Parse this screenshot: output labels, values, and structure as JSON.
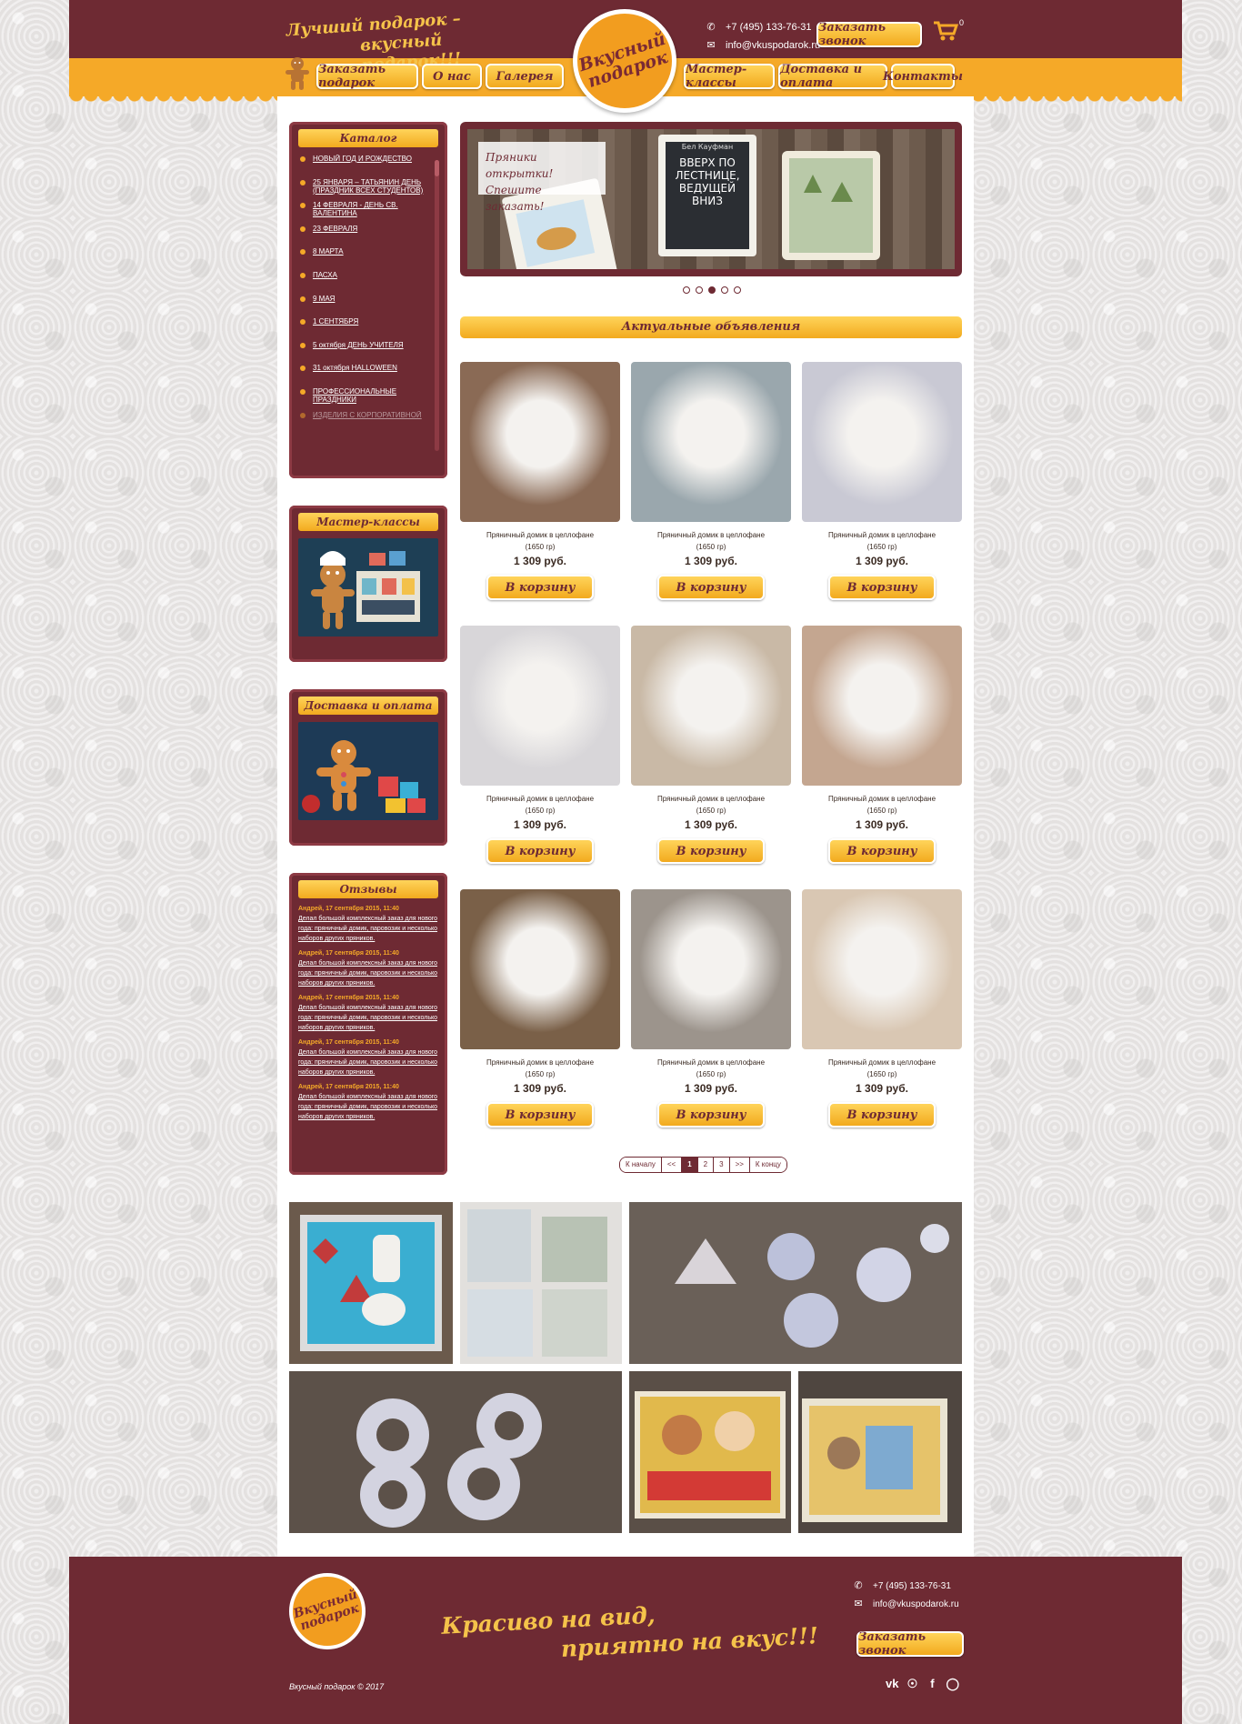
{
  "header": {
    "tagline_1": "Лучший подарок –",
    "tagline_2": "вкусный подарок!!!",
    "logo_text_1": "Вкусный",
    "logo_text_2": "подарок",
    "phone": "+7 (495) 133-76-31",
    "email": "info@vkuspodarok.ru",
    "call_button": "Заказать звонок",
    "cart_count": "0"
  },
  "nav": [
    {
      "label": "Заказать подарок"
    },
    {
      "label": "О нас"
    },
    {
      "label": "Галерея"
    },
    {
      "label": "Мастер-классы"
    },
    {
      "label": "Доставка и оплата"
    },
    {
      "label": "Контакты"
    }
  ],
  "sidebar": {
    "catalog_title": "Каталог",
    "catalog": [
      {
        "label": "НОВЫЙ ГОД И РОЖДЕСТВО"
      },
      {
        "label": "25 ЯНВАРЯ – ТАТЬЯНИН ДЕНЬ (ПРАЗДНИК ВСЕХ СТУДЕНТОВ)"
      },
      {
        "label": "14 ФЕВРАЛЯ - ДЕНЬ СВ. ВАЛЕНТИНА"
      },
      {
        "label": "23 ФЕВРАЛЯ"
      },
      {
        "label": "8 МАРТА"
      },
      {
        "label": "ПАСХА"
      },
      {
        "label": "9 МАЯ"
      },
      {
        "label": "1 СЕНТЯБРЯ"
      },
      {
        "label": "5 октября ДЕНЬ УЧИТЕЛЯ"
      },
      {
        "label": "31 октября HALLOWEEN"
      },
      {
        "label": "ПРОФЕССИОНАЛЬНЫЕ ПРАЗДНИКИ"
      },
      {
        "label": "ИЗДЕЛИЯ С КОРПОРАТИВНОЙ"
      }
    ],
    "masterclass_title": "Мастер-классы",
    "delivery_title": "Доставка и оплата",
    "reviews_title": "Отзывы",
    "reviews": [
      {
        "author": "Андрей,  17 сентября 2015, 11:40",
        "text": "Делал большой комплексный заказ для нового года: пряничный домик, паровозик и несколько наборов других пряников."
      },
      {
        "author": "Андрей,  17 сентября 2015, 11:40",
        "text": "Делал большой комплексный заказ для нового года: пряничный домик, паровозик и несколько наборов других пряников."
      },
      {
        "author": "Андрей,  17 сентября 2015, 11:40",
        "text": "Делал большой комплексный заказ для нового года: пряничный домик, паровозик и несколько наборов других пряников."
      },
      {
        "author": "Андрей,  17 сентября 2015, 11:40",
        "text": "Делал большой комплексный заказ для нового года: пряничный домик, паровозик и несколько наборов других пряников."
      },
      {
        "author": "Андрей,  17 сентября 2015, 11:40",
        "text": "Делал большой комплексный заказ для нового года: пряничный домик, паровозик и несколько наборов других пряников."
      }
    ]
  },
  "slider": {
    "caption_1": "Пряники открытки!",
    "caption_2": "Спешите заказать!",
    "card_text": "Вверх по лестнице, ведущей вниз",
    "card_author": "Бел Кауфман",
    "active_dot": 3
  },
  "announce_title": "Актуальные объявления",
  "products": [
    {
      "name": "Пряничный домик в целлофане",
      "weight": "(1650 гр)",
      "price": "1 309 руб.",
      "button": "В корзину",
      "color": "#8a6a55"
    },
    {
      "name": "Пряничный домик в целлофане",
      "weight": "(1650 гр)",
      "price": "1 309 руб.",
      "button": "В корзину",
      "color": "#9aa7ad"
    },
    {
      "name": "Пряничный домик в целлофане",
      "weight": "(1650 гр)",
      "price": "1 309 руб.",
      "button": "В корзину",
      "color": "#c9c9d4"
    },
    {
      "name": "Пряничный домик в целлофане",
      "weight": "(1650 гр)",
      "price": "1 309 руб.",
      "button": "В корзину",
      "color": "#d8d6d9"
    },
    {
      "name": "Пряничный домик в целлофане",
      "weight": "(1650 гр)",
      "price": "1 309 руб.",
      "button": "В корзину",
      "color": "#c9b9a6"
    },
    {
      "name": "Пряничный домик в целлофане",
      "weight": "(1650 гр)",
      "price": "1 309 руб.",
      "button": "В корзину",
      "color": "#c4a690"
    },
    {
      "name": "Пряничный домик в целлофане",
      "weight": "(1650 гр)",
      "price": "1 309 руб.",
      "button": "В корзину",
      "color": "#7a6048"
    },
    {
      "name": "Пряничный домик в целлофане",
      "weight": "(1650 гр)",
      "price": "1 309 руб.",
      "button": "В корзину",
      "color": "#9c948c"
    },
    {
      "name": "Пряничный домик в целлофане",
      "weight": "(1650 гр)",
      "price": "1 309 руб.",
      "button": "В корзину",
      "color": "#d9c7b3"
    }
  ],
  "pagination": {
    "first": "К началу",
    "prev": "<<",
    "pages": [
      "1",
      "2",
      "3"
    ],
    "next": ">>",
    "last": "К концу"
  },
  "footer": {
    "slogan_1": "Красиво на вид,",
    "slogan_2": "приятно на вкус!!!",
    "phone": "+7 (495) 133-76-31",
    "email": "info@vkuspodarok.ru",
    "call_button": "Заказать звонок",
    "copyright": "Вкусный подарок © 2017",
    "social": [
      "vk-icon",
      "ok-icon",
      "facebook-icon",
      "instagram-icon"
    ]
  },
  "colors": {
    "maroon": "#6e2a33",
    "orange": "#f5a928",
    "gold": "#ffd45a"
  }
}
